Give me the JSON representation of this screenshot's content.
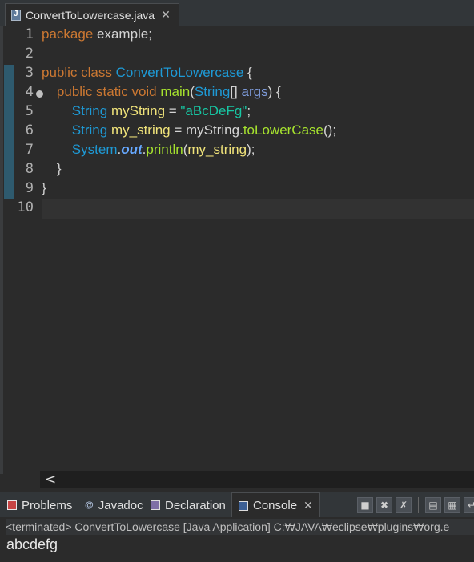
{
  "editor_tab": {
    "label": "ConvertToLowercase.java",
    "close": "✕"
  },
  "line_numbers": [
    "1",
    "2",
    "3",
    "4",
    "5",
    "6",
    "7",
    "8",
    "9",
    "10"
  ],
  "code": {
    "l1": {
      "kw": "package",
      "rest": " example;"
    },
    "l3": {
      "kw": "public class",
      "cls": "ConvertToLowercase",
      "rest": " {"
    },
    "l4": {
      "kw": "public static void",
      "mth": "main",
      "p1": "(",
      "cls": "String",
      "p2": "[] ",
      "arg": "args",
      "p3": ") {"
    },
    "l5": {
      "cls": "String",
      "var": "myString",
      "p1": " = ",
      "str": "\"aBcDeFg\"",
      "p2": ";"
    },
    "l6": {
      "cls": "String",
      "var": "my_string",
      "p1": " = ",
      "v2": "myString",
      "p2": ".",
      "mth": "toLowerCase",
      "p3": "();"
    },
    "l7": {
      "cls": "System",
      "p1": ".",
      "fld": "out",
      "p2": ".",
      "mth": "println",
      "p3": "(",
      "var": "my_string",
      "p4": ");"
    },
    "l8": "}",
    "l9": "}"
  },
  "scroll_left": "<",
  "panel_tabs": {
    "problems": "Problems",
    "javadoc": "Javadoc",
    "declaration": "Declaration",
    "console": "Console",
    "close": "✕"
  },
  "console": {
    "status": "<terminated> ConvertToLowercase [Java Application] C:₩JAVA₩eclipse₩plugins₩org.e",
    "output": "abcdefg"
  },
  "icons": {
    "java_file": "java-file-icon",
    "fold": "collapse-fold-icon",
    "stop": "stop-icon",
    "remove": "remove-launch-icon",
    "remove_all": "remove-all-launches-icon"
  }
}
